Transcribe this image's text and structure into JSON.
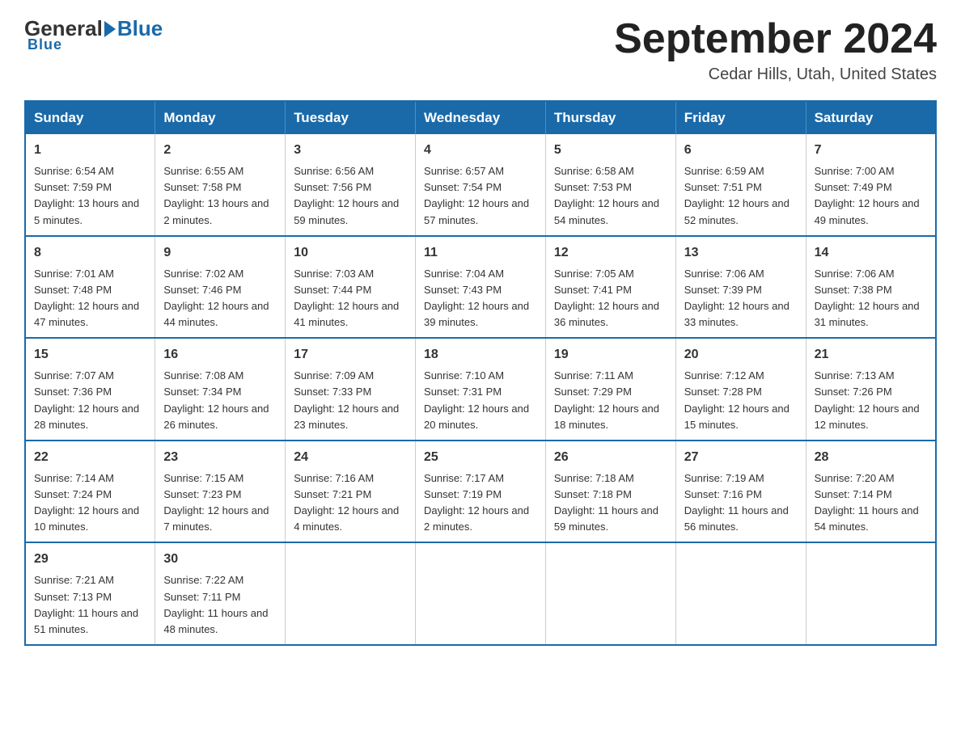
{
  "logo": {
    "general": "General",
    "triangle": "▶",
    "blue": "Blue"
  },
  "header": {
    "month_title": "September 2024",
    "location": "Cedar Hills, Utah, United States"
  },
  "weekdays": [
    "Sunday",
    "Monday",
    "Tuesday",
    "Wednesday",
    "Thursday",
    "Friday",
    "Saturday"
  ],
  "weeks": [
    [
      {
        "day": "1",
        "sunrise": "6:54 AM",
        "sunset": "7:59 PM",
        "daylight": "13 hours and 5 minutes."
      },
      {
        "day": "2",
        "sunrise": "6:55 AM",
        "sunset": "7:58 PM",
        "daylight": "13 hours and 2 minutes."
      },
      {
        "day": "3",
        "sunrise": "6:56 AM",
        "sunset": "7:56 PM",
        "daylight": "12 hours and 59 minutes."
      },
      {
        "day": "4",
        "sunrise": "6:57 AM",
        "sunset": "7:54 PM",
        "daylight": "12 hours and 57 minutes."
      },
      {
        "day": "5",
        "sunrise": "6:58 AM",
        "sunset": "7:53 PM",
        "daylight": "12 hours and 54 minutes."
      },
      {
        "day": "6",
        "sunrise": "6:59 AM",
        "sunset": "7:51 PM",
        "daylight": "12 hours and 52 minutes."
      },
      {
        "day": "7",
        "sunrise": "7:00 AM",
        "sunset": "7:49 PM",
        "daylight": "12 hours and 49 minutes."
      }
    ],
    [
      {
        "day": "8",
        "sunrise": "7:01 AM",
        "sunset": "7:48 PM",
        "daylight": "12 hours and 47 minutes."
      },
      {
        "day": "9",
        "sunrise": "7:02 AM",
        "sunset": "7:46 PM",
        "daylight": "12 hours and 44 minutes."
      },
      {
        "day": "10",
        "sunrise": "7:03 AM",
        "sunset": "7:44 PM",
        "daylight": "12 hours and 41 minutes."
      },
      {
        "day": "11",
        "sunrise": "7:04 AM",
        "sunset": "7:43 PM",
        "daylight": "12 hours and 39 minutes."
      },
      {
        "day": "12",
        "sunrise": "7:05 AM",
        "sunset": "7:41 PM",
        "daylight": "12 hours and 36 minutes."
      },
      {
        "day": "13",
        "sunrise": "7:06 AM",
        "sunset": "7:39 PM",
        "daylight": "12 hours and 33 minutes."
      },
      {
        "day": "14",
        "sunrise": "7:06 AM",
        "sunset": "7:38 PM",
        "daylight": "12 hours and 31 minutes."
      }
    ],
    [
      {
        "day": "15",
        "sunrise": "7:07 AM",
        "sunset": "7:36 PM",
        "daylight": "12 hours and 28 minutes."
      },
      {
        "day": "16",
        "sunrise": "7:08 AM",
        "sunset": "7:34 PM",
        "daylight": "12 hours and 26 minutes."
      },
      {
        "day": "17",
        "sunrise": "7:09 AM",
        "sunset": "7:33 PM",
        "daylight": "12 hours and 23 minutes."
      },
      {
        "day": "18",
        "sunrise": "7:10 AM",
        "sunset": "7:31 PM",
        "daylight": "12 hours and 20 minutes."
      },
      {
        "day": "19",
        "sunrise": "7:11 AM",
        "sunset": "7:29 PM",
        "daylight": "12 hours and 18 minutes."
      },
      {
        "day": "20",
        "sunrise": "7:12 AM",
        "sunset": "7:28 PM",
        "daylight": "12 hours and 15 minutes."
      },
      {
        "day": "21",
        "sunrise": "7:13 AM",
        "sunset": "7:26 PM",
        "daylight": "12 hours and 12 minutes."
      }
    ],
    [
      {
        "day": "22",
        "sunrise": "7:14 AM",
        "sunset": "7:24 PM",
        "daylight": "12 hours and 10 minutes."
      },
      {
        "day": "23",
        "sunrise": "7:15 AM",
        "sunset": "7:23 PM",
        "daylight": "12 hours and 7 minutes."
      },
      {
        "day": "24",
        "sunrise": "7:16 AM",
        "sunset": "7:21 PM",
        "daylight": "12 hours and 4 minutes."
      },
      {
        "day": "25",
        "sunrise": "7:17 AM",
        "sunset": "7:19 PM",
        "daylight": "12 hours and 2 minutes."
      },
      {
        "day": "26",
        "sunrise": "7:18 AM",
        "sunset": "7:18 PM",
        "daylight": "11 hours and 59 minutes."
      },
      {
        "day": "27",
        "sunrise": "7:19 AM",
        "sunset": "7:16 PM",
        "daylight": "11 hours and 56 minutes."
      },
      {
        "day": "28",
        "sunrise": "7:20 AM",
        "sunset": "7:14 PM",
        "daylight": "11 hours and 54 minutes."
      }
    ],
    [
      {
        "day": "29",
        "sunrise": "7:21 AM",
        "sunset": "7:13 PM",
        "daylight": "11 hours and 51 minutes."
      },
      {
        "day": "30",
        "sunrise": "7:22 AM",
        "sunset": "7:11 PM",
        "daylight": "11 hours and 48 minutes."
      },
      null,
      null,
      null,
      null,
      null
    ]
  ]
}
